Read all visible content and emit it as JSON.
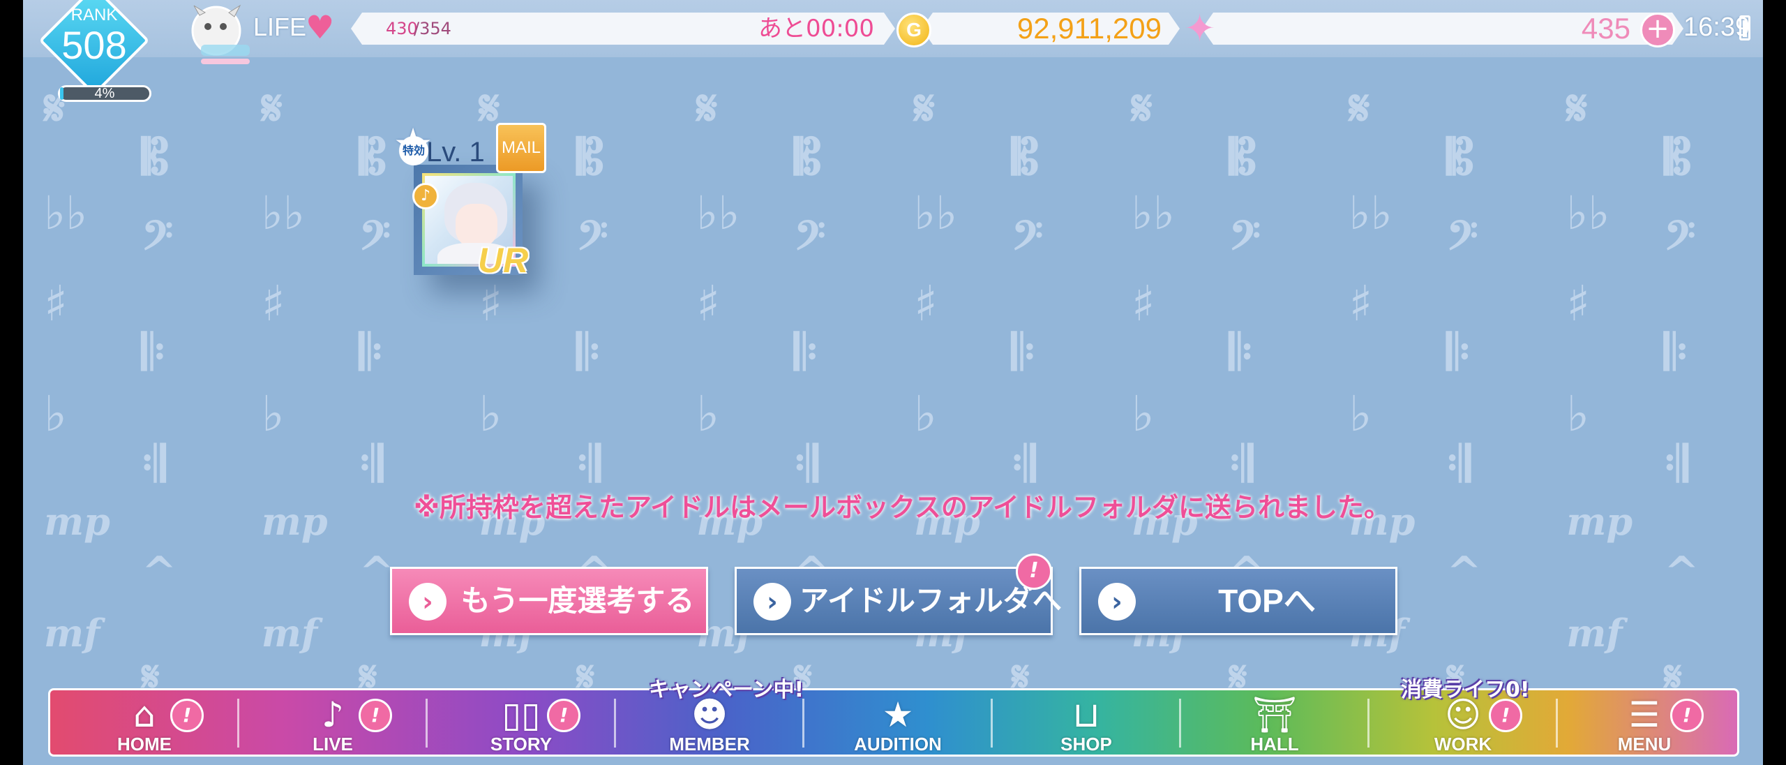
{
  "status_bar": {
    "rank_label": "RANK",
    "rank_value": "508",
    "rank_progress_percent": "4%",
    "rank_progress": 0.04,
    "life_label": "LIFE",
    "life_current": "430",
    "life_max": "/354",
    "life_recovery": "あと00:00",
    "gold_icon_letter": "G",
    "gold_amount": "92,911,209",
    "gems_amount": "435",
    "clock": "16:39"
  },
  "idol_card": {
    "level": "Lv. 1",
    "tokkou_badge": "特効",
    "mail_tag": "MAIL",
    "rarity": "UR"
  },
  "notice": "※所持枠を超えたアイドルはメールボックスのアイドルフォルダに送られました。",
  "buttons": {
    "retry": "もう一度選考する",
    "idol_folder": "アイドルフォルダへ",
    "top": "TOPへ",
    "alert_mark": "!"
  },
  "bottom_nav": {
    "items": [
      {
        "label": "HOME",
        "icon": "home-icon",
        "alert": "!"
      },
      {
        "label": "LIVE",
        "icon": "music-note-icon",
        "alert": "!"
      },
      {
        "label": "STORY",
        "icon": "book-icon",
        "alert": "!"
      },
      {
        "label": "MEMBER",
        "icon": "member-icon"
      },
      {
        "label": "AUDITION",
        "icon": "audition-card-icon"
      },
      {
        "label": "SHOP",
        "icon": "basket-icon"
      },
      {
        "label": "HALL",
        "icon": "hall-icon"
      },
      {
        "label": "WORK",
        "icon": "work-icon",
        "alert": "!"
      },
      {
        "label": "MENU",
        "icon": "menu-list-icon",
        "alert": "!"
      }
    ],
    "member_tag": "キャンペーン中!",
    "work_tag": "消費ライフ0!"
  },
  "colors": {
    "background": "#93b6d9",
    "accent_pink": "#ef4f97",
    "button_blue": "#4b74a9",
    "gold": "#f2b516"
  }
}
